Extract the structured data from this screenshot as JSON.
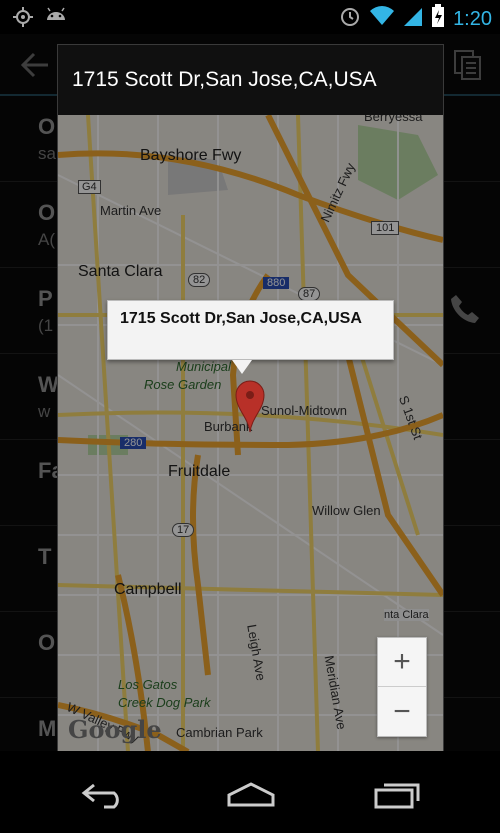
{
  "status_bar": {
    "time": "1:20",
    "icons": [
      "gps-icon",
      "android-icon",
      "alarm-icon",
      "wifi-icon",
      "signal-icon",
      "battery-icon"
    ]
  },
  "background_app": {
    "rows": [
      {
        "t1": "O",
        "t2": "sa"
      },
      {
        "t1": "O",
        "t2": "A("
      },
      {
        "t1": "P",
        "t2": "(1"
      },
      {
        "t1": "W",
        "t2": "w"
      },
      {
        "t1": "Fa",
        "t2": ""
      },
      {
        "t1": "T",
        "t2": ""
      },
      {
        "t1": "O",
        "t2": ""
      },
      {
        "t1": "M",
        "t2": ""
      }
    ]
  },
  "dialog": {
    "title": "1715 Scott Dr,San Jose,CA,USA"
  },
  "map": {
    "info_window": "1715 Scott Dr,San Jose,CA,USA",
    "labels": {
      "bayshore": "Bayshore Fwy",
      "martin": "Martin Ave",
      "santa_clara": "Santa Clara",
      "nimitz": "Nimitz Fwy",
      "berryessa": "Berryessa",
      "municipal": "Municipal",
      "rose_garden": "Rose Garden",
      "burbank": "Burbank",
      "sunol": "Sunol-Midtown",
      "first_st": "S 1st St",
      "fruitdale": "Fruitdale",
      "willow_glen": "Willow Glen",
      "campbell": "Campbell",
      "santa_clara_2": "nta Clara",
      "leigh": "Leigh Ave",
      "meridian": "Meridian Ave",
      "los_gatos": "Los Gatos",
      "creek_dog": "Creek Dog Park",
      "cambrian": "Cambrian Park",
      "w_valley": "W Valley Fwy",
      "g4": "G4",
      "r82": "82",
      "r87": "87",
      "r880": "880",
      "r101": "101",
      "r280": "280",
      "r17": "17"
    },
    "zoom_in": "+",
    "zoom_out": "−",
    "logo": "Google"
  },
  "colors": {
    "accent": "#33b5e5",
    "highway": "#f0a530",
    "marker": "#d93b30"
  }
}
